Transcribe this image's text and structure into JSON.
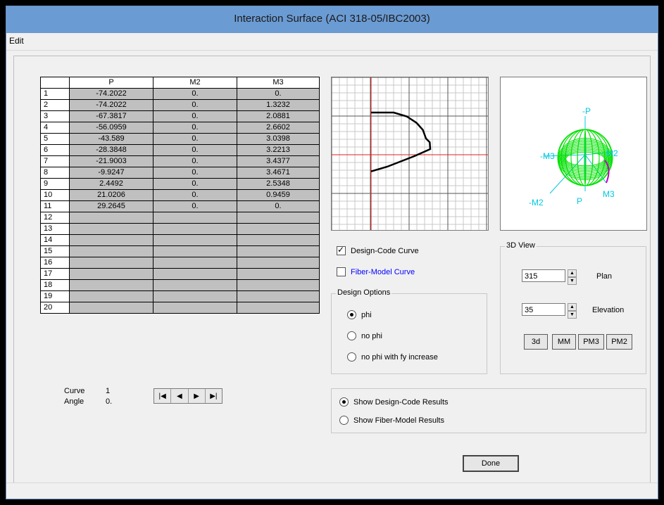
{
  "window": {
    "title": "Interaction Surface  (ACI 318-05/IBC2003)"
  },
  "menu": {
    "edit": "Edit"
  },
  "table": {
    "headers": [
      "",
      "P",
      "M2",
      "M3"
    ],
    "rows": [
      [
        "1",
        "-74.2022",
        "0.",
        "0."
      ],
      [
        "2",
        "-74.2022",
        "0.",
        "1.3232"
      ],
      [
        "3",
        "-67.3817",
        "0.",
        "2.0881"
      ],
      [
        "4",
        "-56.0959",
        "0.",
        "2.6602"
      ],
      [
        "5",
        "-43.589",
        "0.",
        "3.0398"
      ],
      [
        "6",
        "-28.3848",
        "0.",
        "3.2213"
      ],
      [
        "7",
        "-21.9003",
        "0.",
        "3.4377"
      ],
      [
        "8",
        "-9.9247",
        "0.",
        "3.4671"
      ],
      [
        "9",
        "2.4492",
        "0.",
        "2.5348"
      ],
      [
        "10",
        "21.0206",
        "0.",
        "0.9459"
      ],
      [
        "11",
        "29.2645",
        "0.",
        "0."
      ],
      [
        "12",
        "",
        "",
        ""
      ],
      [
        "13",
        "",
        "",
        ""
      ],
      [
        "14",
        "",
        "",
        ""
      ],
      [
        "15",
        "",
        "",
        ""
      ],
      [
        "16",
        "",
        "",
        ""
      ],
      [
        "17",
        "",
        "",
        ""
      ],
      [
        "18",
        "",
        "",
        ""
      ],
      [
        "19",
        "",
        "",
        ""
      ],
      [
        "20",
        "",
        "",
        ""
      ]
    ]
  },
  "curve": {
    "curve_label": "Curve",
    "curve_value": "1",
    "angle_label": "Angle",
    "angle_value": "0."
  },
  "nav_buttons": [
    "first-icon",
    "prev-icon",
    "next-icon",
    "last-icon"
  ],
  "options": {
    "design_code_curve": {
      "label": "Design-Code Curve",
      "checked": true
    },
    "fiber_model_curve": {
      "label": "Fiber-Model Curve",
      "checked": false
    },
    "design_options_title": "Design Options",
    "design_options": [
      {
        "label": "phi",
        "selected": true
      },
      {
        "label": "no phi",
        "selected": false
      },
      {
        "label": "no phi with fy increase",
        "selected": false
      }
    ]
  },
  "view3d": {
    "title": "3D View",
    "plan_label": "Plan",
    "plan_value": "315",
    "elevation_label": "Elevation",
    "elevation_value": "35",
    "buttons": [
      "3d",
      "MM",
      "PM3",
      "PM2"
    ],
    "axis_labels": {
      "p_top": "-P",
      "p_bottom": "P",
      "m2_neg": "-M2",
      "m3": "M3",
      "m3_neg": "-M3",
      "m2": "M2"
    }
  },
  "results": [
    {
      "label": "Show Design-Code Results",
      "selected": true
    },
    {
      "label": "Show Fiber-Model Results",
      "selected": false
    }
  ],
  "done_label": "Done",
  "colors": {
    "titlebar": "#6b9bd3",
    "grid_cell": "#c0c0c0",
    "axis_red": "#e02020",
    "surface_green": "#00e000",
    "axis_cyan": "#00c8e0",
    "link_blue": "#0000ff"
  },
  "curve_plot": {
    "points_m3_p": [
      [
        0.0,
        -74.2022
      ],
      [
        1.3232,
        -74.2022
      ],
      [
        2.0881,
        -67.3817
      ],
      [
        2.6602,
        -56.0959
      ],
      [
        3.0398,
        -43.589
      ],
      [
        3.2213,
        -28.3848
      ],
      [
        3.4377,
        -21.9003
      ],
      [
        3.4671,
        -9.9247
      ],
      [
        2.5348,
        2.4492
      ],
      [
        0.9459,
        21.0206
      ],
      [
        0.0,
        29.2645
      ]
    ]
  }
}
